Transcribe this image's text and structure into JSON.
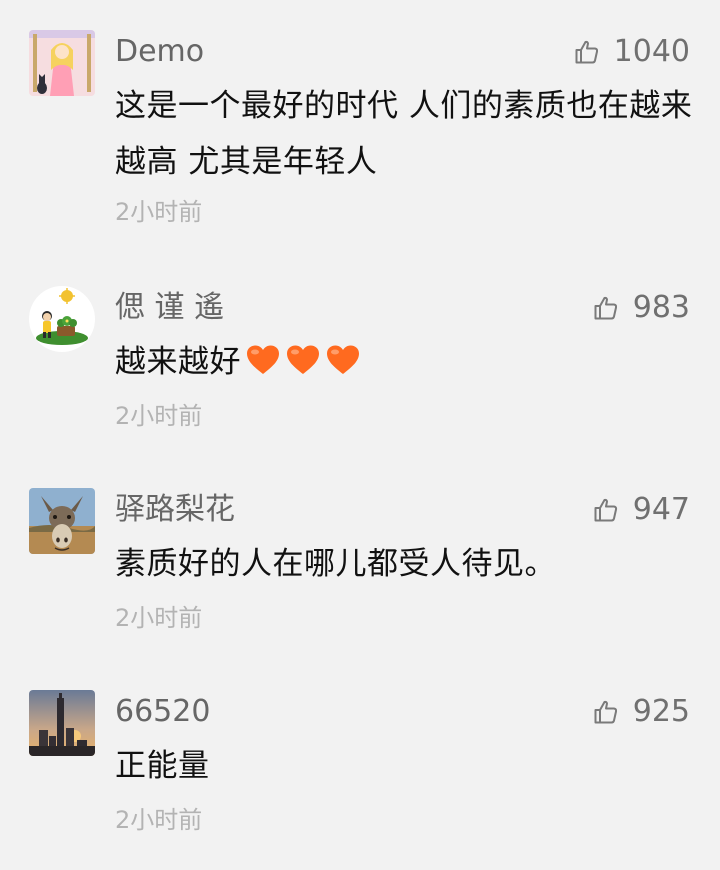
{
  "comments": [
    {
      "username": "Demo",
      "likes": "1040",
      "text": "这是一个最好的时代 人们的素质也在越来越高 尤其是年轻人",
      "time": "2小时前",
      "avatar": "cartoon-girl-avatar"
    },
    {
      "username": "偲 谨 遙",
      "likes": "983",
      "text": "越来越好",
      "emoji_count": 3,
      "emoji": "orange-heart",
      "time": "2小时前",
      "avatar": "cartoon-child-avatar"
    },
    {
      "username": "驿路梨花",
      "likes": "947",
      "text": "素质好的人在哪儿都受人待见。",
      "time": "2小时前",
      "avatar": "donkey-avatar"
    },
    {
      "username": "66520",
      "likes": "925",
      "text": "正能量",
      "time": "2小时前",
      "avatar": "city-sunset-avatar"
    }
  ],
  "icons": {
    "like": "thumbs-up-icon"
  },
  "colors": {
    "background": "#f2f2f2",
    "heart": "#ff6a1f"
  }
}
